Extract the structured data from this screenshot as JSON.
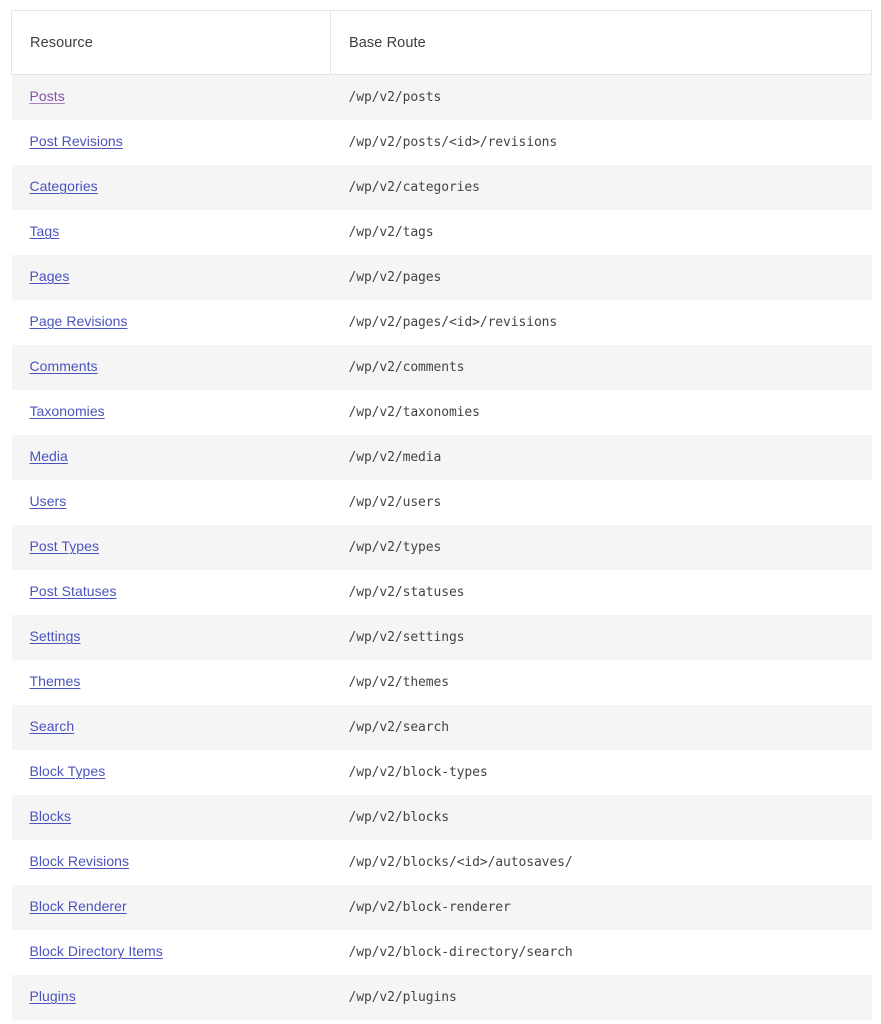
{
  "table": {
    "columns": [
      {
        "key": "resource",
        "label": "Resource"
      },
      {
        "key": "route",
        "label": "Base Route"
      }
    ],
    "colors": {
      "link": "#4b53bd",
      "link_visited": "#8a4fa8",
      "row_stripe": "#f5f5f6",
      "row_plain": "#ffffff",
      "border": "#e6e6ea",
      "header_text": "#3c3c43",
      "route_text": "#434349"
    },
    "rows": [
      {
        "resource": "Posts",
        "route": "/wp/v2/posts",
        "visited": true
      },
      {
        "resource": "Post Revisions",
        "route": "/wp/v2/posts/<id>/revisions",
        "visited": false
      },
      {
        "resource": "Categories",
        "route": "/wp/v2/categories",
        "visited": false
      },
      {
        "resource": "Tags",
        "route": "/wp/v2/tags",
        "visited": false
      },
      {
        "resource": "Pages",
        "route": "/wp/v2/pages",
        "visited": false
      },
      {
        "resource": "Page Revisions",
        "route": "/wp/v2/pages/<id>/revisions",
        "visited": false
      },
      {
        "resource": "Comments",
        "route": "/wp/v2/comments",
        "visited": false
      },
      {
        "resource": "Taxonomies",
        "route": "/wp/v2/taxonomies",
        "visited": false
      },
      {
        "resource": "Media",
        "route": "/wp/v2/media",
        "visited": false
      },
      {
        "resource": "Users",
        "route": "/wp/v2/users",
        "visited": false
      },
      {
        "resource": "Post Types",
        "route": "/wp/v2/types",
        "visited": false
      },
      {
        "resource": "Post Statuses",
        "route": "/wp/v2/statuses",
        "visited": false
      },
      {
        "resource": "Settings",
        "route": "/wp/v2/settings",
        "visited": false
      },
      {
        "resource": "Themes",
        "route": "/wp/v2/themes",
        "visited": false
      },
      {
        "resource": "Search",
        "route": "/wp/v2/search",
        "visited": false
      },
      {
        "resource": "Block Types",
        "route": "/wp/v2/block-types",
        "visited": false
      },
      {
        "resource": "Blocks",
        "route": "/wp/v2/blocks",
        "visited": false
      },
      {
        "resource": "Block Revisions",
        "route": "/wp/v2/blocks/<id>/autosaves/",
        "visited": false
      },
      {
        "resource": "Block Renderer",
        "route": "/wp/v2/block-renderer",
        "visited": false
      },
      {
        "resource": "Block Directory Items",
        "route": "/wp/v2/block-directory/search",
        "visited": false
      },
      {
        "resource": "Plugins",
        "route": "/wp/v2/plugins",
        "visited": false
      }
    ]
  }
}
